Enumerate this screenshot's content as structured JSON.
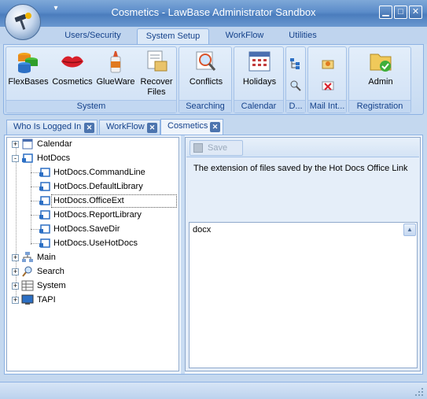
{
  "window": {
    "title": "Cosmetics - LawBase Administrator Sandbox",
    "qat_icon": "chevron-down-icon"
  },
  "ribbon": {
    "tabs": [
      {
        "label": "Users/Security",
        "active": false
      },
      {
        "label": "System Setup",
        "active": true
      },
      {
        "label": "WorkFlow",
        "active": false
      },
      {
        "label": "Utilities",
        "active": false
      }
    ],
    "groups": {
      "system": {
        "label": "System",
        "buttons": [
          "FlexBases",
          "Cosmetics",
          "GlueWare",
          "Recover Files"
        ]
      },
      "searching": {
        "label": "Searching",
        "buttons": [
          "Conflicts"
        ]
      },
      "calendar": {
        "label": "Calendar",
        "buttons": [
          "Holidays"
        ]
      },
      "d": {
        "label": "D..."
      },
      "mail": {
        "label": "Mail Int..."
      },
      "registration": {
        "label": "Registration",
        "buttons": [
          "Admin"
        ]
      }
    }
  },
  "doc_tabs": [
    {
      "label": "Who Is Logged In",
      "active": false
    },
    {
      "label": "WorkFlow",
      "active": false
    },
    {
      "label": "Cosmetics",
      "active": true
    }
  ],
  "tree": {
    "nodes": [
      {
        "label": "Calendar",
        "expander": "+"
      },
      {
        "label": "HotDocs",
        "expander": "-"
      },
      {
        "label": "HotDocs.CommandLine"
      },
      {
        "label": "HotDocs.DefaultLibrary"
      },
      {
        "label": "HotDocs.OfficeExt",
        "selected": true
      },
      {
        "label": "HotDocs.ReportLibrary"
      },
      {
        "label": "HotDocs.SaveDir"
      },
      {
        "label": "HotDocs.UseHotDocs"
      },
      {
        "label": "Main",
        "expander": "+"
      },
      {
        "label": "Search",
        "expander": "+"
      },
      {
        "label": "System",
        "expander": "+"
      },
      {
        "label": "TAPI",
        "expander": "+"
      }
    ]
  },
  "detail": {
    "save_label": "Save",
    "description": "The extension of files saved by the Hot Docs Office Link",
    "value": "docx"
  },
  "colors": {
    "accent": "#15428b",
    "ribbon_bg": "#dbe8f7",
    "titlebar": "#5b8cc9"
  }
}
